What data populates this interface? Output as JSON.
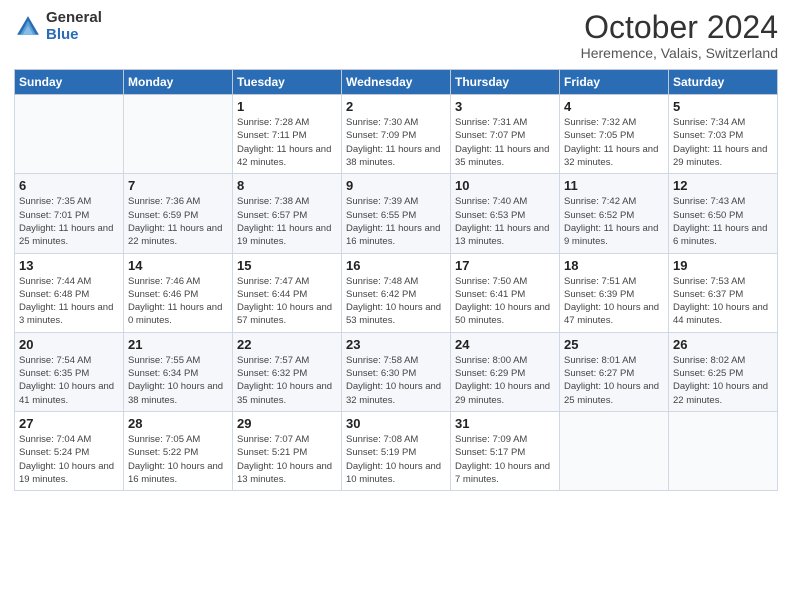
{
  "header": {
    "logo_general": "General",
    "logo_blue": "Blue",
    "month_title": "October 2024",
    "location": "Heremence, Valais, Switzerland"
  },
  "days_of_week": [
    "Sunday",
    "Monday",
    "Tuesday",
    "Wednesday",
    "Thursday",
    "Friday",
    "Saturday"
  ],
  "weeks": [
    [
      {
        "day": "",
        "info": ""
      },
      {
        "day": "",
        "info": ""
      },
      {
        "day": "1",
        "info": "Sunrise: 7:28 AM\nSunset: 7:11 PM\nDaylight: 11 hours and 42 minutes."
      },
      {
        "day": "2",
        "info": "Sunrise: 7:30 AM\nSunset: 7:09 PM\nDaylight: 11 hours and 38 minutes."
      },
      {
        "day": "3",
        "info": "Sunrise: 7:31 AM\nSunset: 7:07 PM\nDaylight: 11 hours and 35 minutes."
      },
      {
        "day": "4",
        "info": "Sunrise: 7:32 AM\nSunset: 7:05 PM\nDaylight: 11 hours and 32 minutes."
      },
      {
        "day": "5",
        "info": "Sunrise: 7:34 AM\nSunset: 7:03 PM\nDaylight: 11 hours and 29 minutes."
      }
    ],
    [
      {
        "day": "6",
        "info": "Sunrise: 7:35 AM\nSunset: 7:01 PM\nDaylight: 11 hours and 25 minutes."
      },
      {
        "day": "7",
        "info": "Sunrise: 7:36 AM\nSunset: 6:59 PM\nDaylight: 11 hours and 22 minutes."
      },
      {
        "day": "8",
        "info": "Sunrise: 7:38 AM\nSunset: 6:57 PM\nDaylight: 11 hours and 19 minutes."
      },
      {
        "day": "9",
        "info": "Sunrise: 7:39 AM\nSunset: 6:55 PM\nDaylight: 11 hours and 16 minutes."
      },
      {
        "day": "10",
        "info": "Sunrise: 7:40 AM\nSunset: 6:53 PM\nDaylight: 11 hours and 13 minutes."
      },
      {
        "day": "11",
        "info": "Sunrise: 7:42 AM\nSunset: 6:52 PM\nDaylight: 11 hours and 9 minutes."
      },
      {
        "day": "12",
        "info": "Sunrise: 7:43 AM\nSunset: 6:50 PM\nDaylight: 11 hours and 6 minutes."
      }
    ],
    [
      {
        "day": "13",
        "info": "Sunrise: 7:44 AM\nSunset: 6:48 PM\nDaylight: 11 hours and 3 minutes."
      },
      {
        "day": "14",
        "info": "Sunrise: 7:46 AM\nSunset: 6:46 PM\nDaylight: 11 hours and 0 minutes."
      },
      {
        "day": "15",
        "info": "Sunrise: 7:47 AM\nSunset: 6:44 PM\nDaylight: 10 hours and 57 minutes."
      },
      {
        "day": "16",
        "info": "Sunrise: 7:48 AM\nSunset: 6:42 PM\nDaylight: 10 hours and 53 minutes."
      },
      {
        "day": "17",
        "info": "Sunrise: 7:50 AM\nSunset: 6:41 PM\nDaylight: 10 hours and 50 minutes."
      },
      {
        "day": "18",
        "info": "Sunrise: 7:51 AM\nSunset: 6:39 PM\nDaylight: 10 hours and 47 minutes."
      },
      {
        "day": "19",
        "info": "Sunrise: 7:53 AM\nSunset: 6:37 PM\nDaylight: 10 hours and 44 minutes."
      }
    ],
    [
      {
        "day": "20",
        "info": "Sunrise: 7:54 AM\nSunset: 6:35 PM\nDaylight: 10 hours and 41 minutes."
      },
      {
        "day": "21",
        "info": "Sunrise: 7:55 AM\nSunset: 6:34 PM\nDaylight: 10 hours and 38 minutes."
      },
      {
        "day": "22",
        "info": "Sunrise: 7:57 AM\nSunset: 6:32 PM\nDaylight: 10 hours and 35 minutes."
      },
      {
        "day": "23",
        "info": "Sunrise: 7:58 AM\nSunset: 6:30 PM\nDaylight: 10 hours and 32 minutes."
      },
      {
        "day": "24",
        "info": "Sunrise: 8:00 AM\nSunset: 6:29 PM\nDaylight: 10 hours and 29 minutes."
      },
      {
        "day": "25",
        "info": "Sunrise: 8:01 AM\nSunset: 6:27 PM\nDaylight: 10 hours and 25 minutes."
      },
      {
        "day": "26",
        "info": "Sunrise: 8:02 AM\nSunset: 6:25 PM\nDaylight: 10 hours and 22 minutes."
      }
    ],
    [
      {
        "day": "27",
        "info": "Sunrise: 7:04 AM\nSunset: 5:24 PM\nDaylight: 10 hours and 19 minutes."
      },
      {
        "day": "28",
        "info": "Sunrise: 7:05 AM\nSunset: 5:22 PM\nDaylight: 10 hours and 16 minutes."
      },
      {
        "day": "29",
        "info": "Sunrise: 7:07 AM\nSunset: 5:21 PM\nDaylight: 10 hours and 13 minutes."
      },
      {
        "day": "30",
        "info": "Sunrise: 7:08 AM\nSunset: 5:19 PM\nDaylight: 10 hours and 10 minutes."
      },
      {
        "day": "31",
        "info": "Sunrise: 7:09 AM\nSunset: 5:17 PM\nDaylight: 10 hours and 7 minutes."
      },
      {
        "day": "",
        "info": ""
      },
      {
        "day": "",
        "info": ""
      }
    ]
  ]
}
